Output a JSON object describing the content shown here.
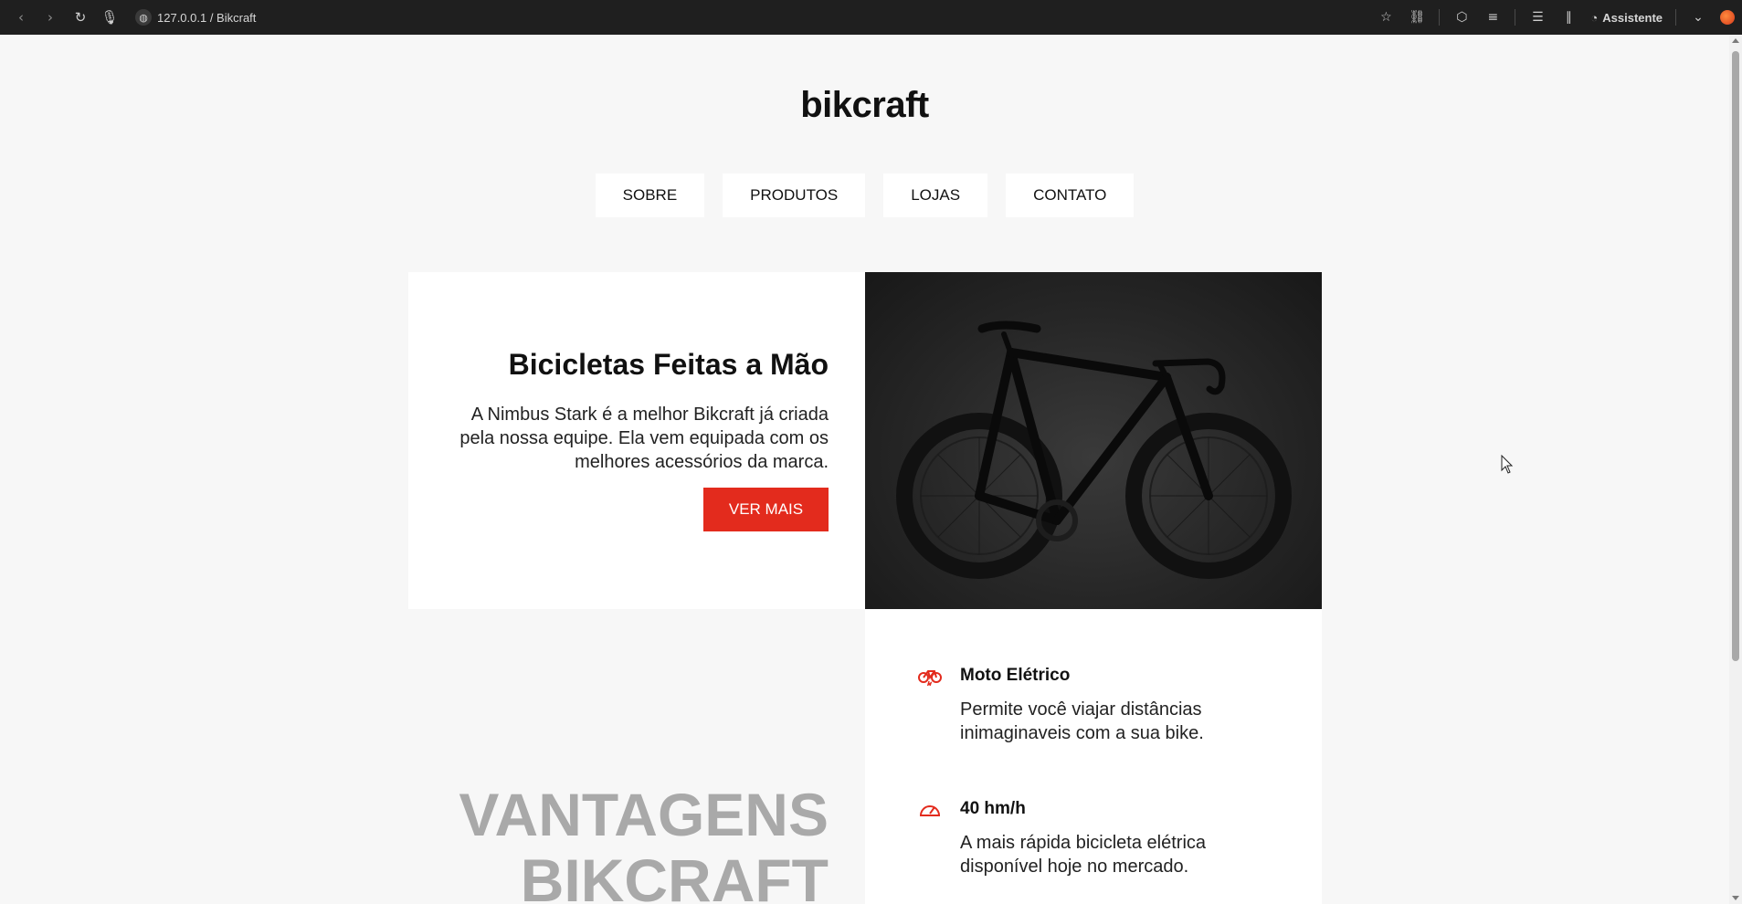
{
  "browser": {
    "address": "127.0.0.1 / Bikcraft",
    "assistant_label": "Assistente"
  },
  "site": {
    "brand": "bikcraft",
    "menu": [
      "SOBRE",
      "PRODUTOS",
      "LOJAS",
      "CONTATO"
    ]
  },
  "hero": {
    "title": "Bicicletas Feitas a Mão",
    "description": "A Nimbus Stark é a melhor Bikcraft já criada pela nossa equipe. Ela vem equipada com os melhores acessórios da marca.",
    "button": "VER MAIS"
  },
  "advantages": {
    "title_line1": "VANTAGENS",
    "title_line2": "BIKCRAFT",
    "items": [
      {
        "icon": "electric-bike-icon",
        "title": "Moto Elétrico",
        "text": "Permite você viajar distâncias inimaginaveis com a sua bike."
      },
      {
        "icon": "speedometer-icon",
        "title": "40 hm/h",
        "text": "A mais rápida bicicleta elétrica disponível hoje no mercado."
      }
    ]
  },
  "colors": {
    "accent": "#e32b1d",
    "background": "#f7f7f7",
    "advantages_title": "#a9a9a9"
  }
}
